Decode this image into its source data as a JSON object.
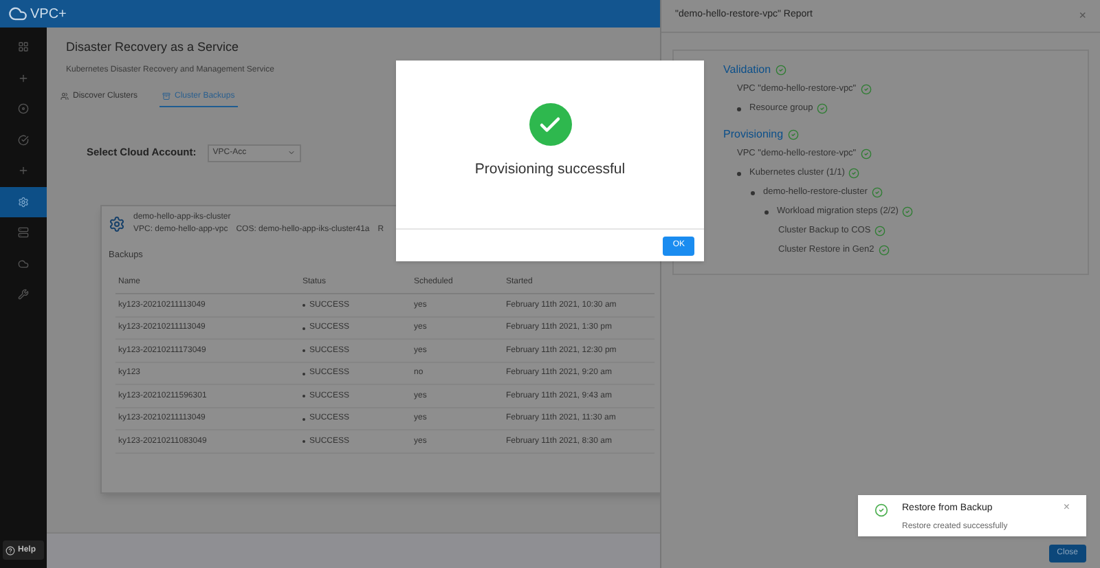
{
  "app": {
    "logo": "VPC+",
    "help": "Help"
  },
  "sidebar": {
    "items": [
      {
        "selected": false
      },
      {
        "selected": false
      },
      {
        "selected": false
      },
      {
        "selected": false
      },
      {
        "selected": false
      },
      {
        "selected": true
      },
      {
        "selected": false
      },
      {
        "selected": false
      },
      {
        "selected": false
      }
    ]
  },
  "page": {
    "title": "Disaster Recovery as a Service",
    "subtitle": "Kubernetes Disaster Recovery and Management Service",
    "tabs": [
      {
        "label": "Discover Clusters",
        "selected": false
      },
      {
        "label": "Cluster Backups",
        "selected": true
      }
    ],
    "account": {
      "label": "Select Cloud Account:",
      "value": "VPC-Acc"
    }
  },
  "cluster": {
    "name": "demo-hello-app-iks-cluster",
    "details": [
      "VPC: demo-hello-app-vpc",
      "COS: demo-hello-app-iks-cluster41a",
      "R"
    ],
    "section": "Backups",
    "columns": [
      "Name",
      "Status",
      "Scheduled",
      "Started"
    ],
    "rows": [
      [
        "ky123-20210211113049",
        "SUCCESS",
        "yes",
        "February 11th 2021, 10:30 am"
      ],
      [
        "ky123-20210211113049",
        "SUCCESS",
        "yes",
        "February 11th 2021, 1:30 pm"
      ],
      [
        "ky123-20210211173049",
        "SUCCESS",
        "yes",
        "February 11th 2021, 12:30 pm"
      ],
      [
        "ky123",
        "SUCCESS",
        "no",
        "February 11th 2021, 9:20 am"
      ],
      [
        "ky123-20210211596301",
        "SUCCESS",
        "yes",
        "February 11th 2021, 9:43 am"
      ],
      [
        "ky123-20210211113049",
        "SUCCESS",
        "yes",
        "February 11th 2021, 11:30 am"
      ],
      [
        "ky123-20210211083049",
        "SUCCESS",
        "yes",
        "February 11th 2021, 8:30 am"
      ]
    ]
  },
  "drawer": {
    "title": "\"demo-hello-restore-vpc\" Report",
    "close": "×",
    "button": "Close",
    "tree": [
      {
        "kind": "section",
        "label": "Validation",
        "children": [
          {
            "kind": "leaf",
            "label": "VPC \"demo-hello-restore-vpc\""
          },
          {
            "kind": "node",
            "label": "Resource group"
          }
        ]
      },
      {
        "kind": "section",
        "label": "Provisioning",
        "children": [
          {
            "kind": "leaf",
            "label": "VPC \"demo-hello-restore-vpc\""
          },
          {
            "kind": "node",
            "label": "Kubernetes cluster (1/1)",
            "children": [
              {
                "kind": "node",
                "label": "demo-hello-restore-cluster",
                "children": [
                  {
                    "kind": "node",
                    "label": "Workload migration steps (2/2)",
                    "children": [
                      {
                        "kind": "leaf",
                        "label": "Cluster Backup to COS"
                      },
                      {
                        "kind": "leaf",
                        "label": "Cluster Restore in Gen2"
                      }
                    ]
                  }
                ]
              }
            ]
          }
        ]
      }
    ]
  },
  "modal": {
    "message": "Provisioning successful",
    "button": "OK"
  },
  "toast": {
    "title": "Restore from Backup",
    "message": "Restore created successfully",
    "close": "×"
  }
}
